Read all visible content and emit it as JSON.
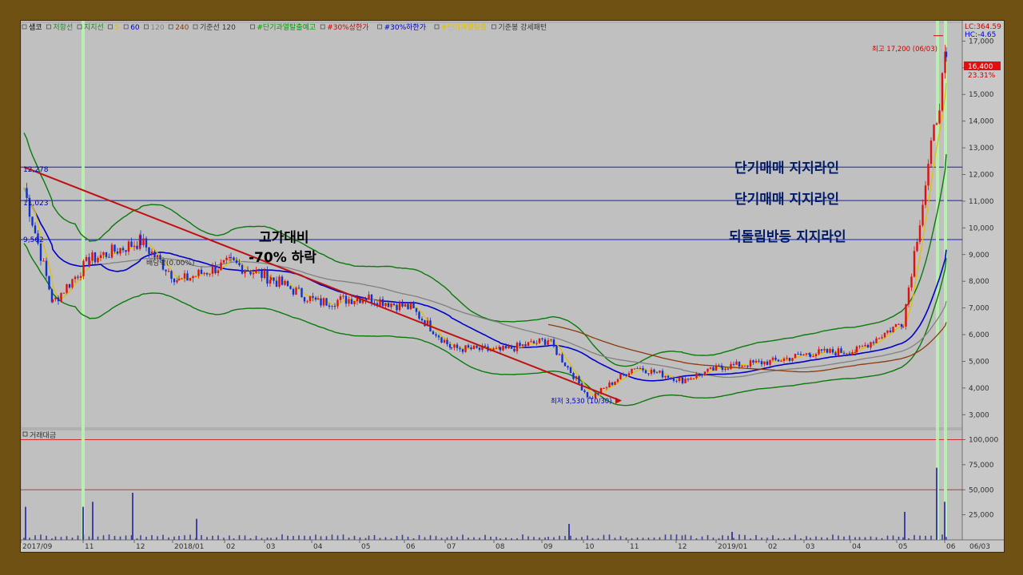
{
  "legend": [
    {
      "text": "샘코",
      "color": "#000000"
    },
    {
      "text": "저항선",
      "color": "#1a8c1a"
    },
    {
      "text": "지지선",
      "color": "#1a8c1a"
    },
    {
      "text": "5",
      "color": "#e0c000"
    },
    {
      "text": "60",
      "color": "#0000cc"
    },
    {
      "text": "120",
      "color": "#808080"
    },
    {
      "text": "240",
      "color": "#8b3a0a"
    },
    {
      "text": "기준선 120",
      "color": "#333333"
    },
    {
      "text": "#단기과열탈출예고",
      "color": "#00a000"
    },
    {
      "text": "#30%상한가",
      "color": "#cc0000"
    },
    {
      "text": "#30%하한가",
      "color": "#0000aa"
    },
    {
      "text": "#단기과열탈출",
      "color": "#e0c000"
    },
    {
      "text": "기준봉 강세패턴",
      "color": "#333333"
    }
  ],
  "readout": {
    "lc": "LC:364.59",
    "hc": "HC:-4.65"
  },
  "annotations": {
    "high": "최고 17,200 (06/03)",
    "low": "최저 3,530 (10/30)",
    "dividend": "배당락(0.00%)",
    "drop_line1": "고가대비",
    "drop_line2": "-70% 하락",
    "support1": "단기매매 지지라인",
    "support2": "단기매매 지지라인",
    "support3": "되돌림반등 지지라인",
    "lvl1": "12,278",
    "lvl2": "11,023",
    "lvl3": "9,562",
    "current_price": "16,400",
    "current_pct": "23.31%"
  },
  "volume_title": "거래대금",
  "x_ticks": [
    "2017/09",
    "11",
    "12",
    "2018/01",
    "02",
    "03",
    "04",
    "05",
    "06",
    "07",
    "08",
    "09",
    "10",
    "11",
    "12",
    "2019/01",
    "02",
    "03",
    "04",
    "05",
    "06"
  ],
  "x_end_label": "06/03",
  "chart_data": {
    "type": "candlestick",
    "title": "",
    "price_axis": {
      "ticks": [
        3000,
        4000,
        5000,
        6000,
        7000,
        8000,
        9000,
        10000,
        11000,
        12000,
        13000,
        14000,
        15000,
        16000,
        17000
      ],
      "tick_labels": [
        "3,000",
        "4,000",
        "5,000",
        "6,000",
        "7,000",
        "8,000",
        "9,000",
        "10,000",
        "11,000",
        "12,000",
        "13,000",
        "14,000",
        "15,000",
        "16,000",
        "17,000"
      ],
      "range": [
        2500,
        17700
      ]
    },
    "volume_axis": {
      "ticks": [
        25000,
        50000,
        75000,
        100000
      ],
      "tick_labels": [
        "25,000",
        "50,000",
        "75,000",
        "100,000"
      ],
      "range": [
        0,
        110000
      ]
    },
    "support_lines": [
      12278,
      11023,
      9562
    ],
    "trend_line": {
      "from": {
        "date": "2017/09",
        "price": 12278
      },
      "to": {
        "date": "2018/10/30",
        "price": 3530
      }
    },
    "close_series": {
      "months": [
        "2017/09",
        "2017/10",
        "2017/11",
        "2017/12",
        "2018/01",
        "2018/02",
        "2018/03",
        "2018/04",
        "2018/05",
        "2018/06",
        "2018/07",
        "2018/08",
        "2018/09",
        "2018/10",
        "2018/11",
        "2018/12",
        "2019/01",
        "2019/02",
        "2019/03",
        "2019/04",
        "2019/05",
        "2019/06"
      ],
      "values": [
        11500,
        7200,
        8800,
        9500,
        8000,
        8700,
        8100,
        7200,
        7400,
        7000,
        5500,
        5400,
        5800,
        3600,
        4800,
        4300,
        4800,
        5000,
        5300,
        5400,
        6500,
        16400
      ]
    },
    "extremes": {
      "high": 17200,
      "high_date": "06/03",
      "low": 3530,
      "low_date": "10/30"
    },
    "volume_spikes": [
      {
        "date": "2017/09",
        "value": 33000
      },
      {
        "date": "2017/11",
        "value": 33000
      },
      {
        "date": "2017/11",
        "value": 38000
      },
      {
        "date": "2017/12",
        "value": 47000
      },
      {
        "date": "2018/01",
        "value": 21000
      },
      {
        "date": "2018/09",
        "value": 16000
      },
      {
        "date": "2019/01",
        "value": 8000
      },
      {
        "date": "2019/05",
        "value": 28000
      },
      {
        "date": "2019/06",
        "value": 72000
      },
      {
        "date": "2019/06",
        "value": 38000
      }
    ],
    "grid": false
  }
}
